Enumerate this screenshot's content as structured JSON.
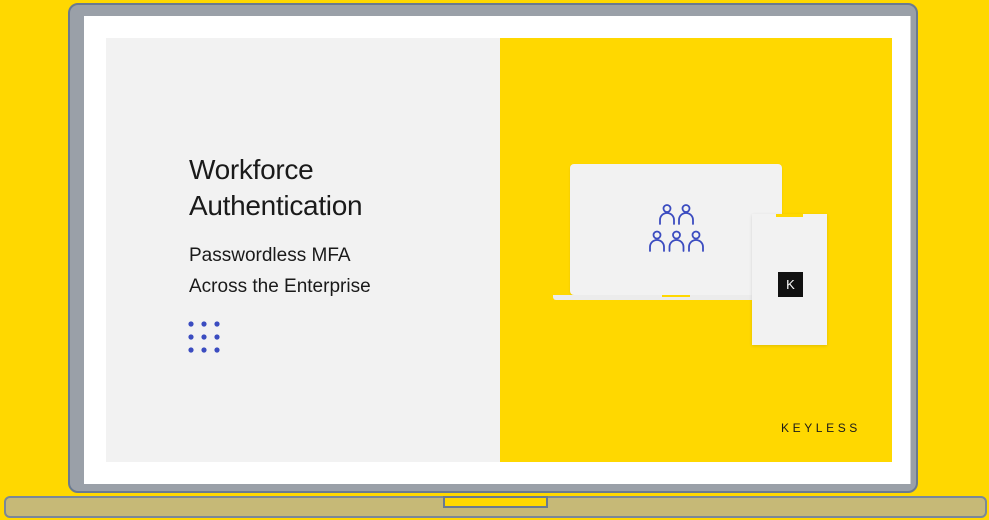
{
  "slide": {
    "title_line1": "Workforce",
    "title_line2": "Authentication",
    "subtitle_line1": "Passwordless MFA",
    "subtitle_line2": "Across the Enterprise",
    "phone_logo_letter": "K",
    "brand_name": "KEYLESS"
  },
  "icons": {
    "dot_grid": "dot-grid-icon",
    "people": "people-group-icon",
    "logo": "keyless-k-logo"
  },
  "colors": {
    "background_yellow": "#FFD800",
    "slide_panel_gray": "#F2F2F2",
    "accent_blue": "#3B4CC0",
    "text_dark": "#1A1A1A"
  }
}
